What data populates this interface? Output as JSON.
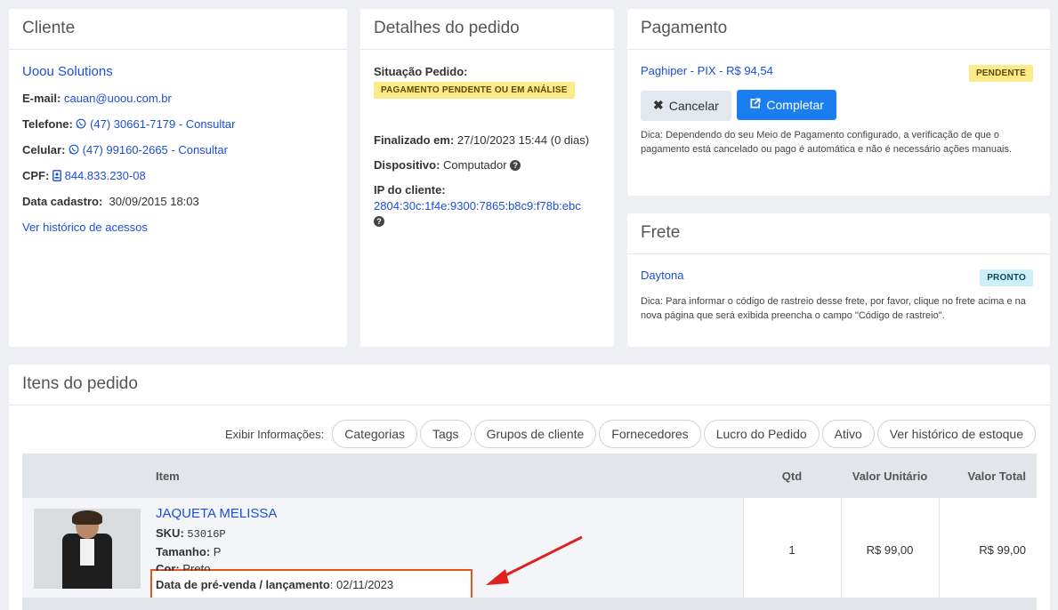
{
  "cliente": {
    "title": "Cliente",
    "name": "Uoou Solutions",
    "email_label": "E-mail:",
    "email": "cauan@uoou.com.br",
    "telefone_label": "Telefone:",
    "telefone": "(47) 30661-7179 - Consultar",
    "celular_label": "Celular:",
    "celular": "(47) 99160-2665 - Consultar",
    "cpf_label": "CPF:",
    "cpf": "844.833.230-08",
    "data_cadastro_label": "Data cadastro:",
    "data_cadastro": "30/09/2015 18:03",
    "historico_link": "Ver histórico de acessos"
  },
  "detalhes": {
    "title": "Detalhes do pedido",
    "situacao_label": "Situação Pedido:",
    "situacao_badge": "PAGAMENTO PENDENTE OU EM ANÁLISE",
    "finalizado_label": "Finalizado em:",
    "finalizado": "27/10/2023 15:44 (0 dias)",
    "dispositivo_label": "Dispositivo:",
    "dispositivo": "Computador",
    "ip_label": "IP do cliente:",
    "ip": "2804:30c:1f4e:9300:7865:b8c9:f78b:ebc"
  },
  "pagamento": {
    "title": "Pagamento",
    "method": "Paghiper - PIX - R$ 94,54",
    "status": "PENDENTE",
    "cancel_label": "Cancelar",
    "complete_label": "Completar",
    "hint": "Dica: Dependendo do seu Meio de Pagamento configurado, a verificação de que o pagamento está cancelado ou pago é automática e não é necessário ações manuais."
  },
  "frete": {
    "title": "Frete",
    "carrier": "Daytona",
    "status": "PRONTO",
    "hint": "Dica: Para informar o código de rastreio desse frete, por favor, clique no frete acima e na nova página que será exibida preencha o campo \"Código de rastreio\"."
  },
  "itens": {
    "title": "Itens do pedido",
    "exibir_label": "Exibir Informações:",
    "filters": [
      "Categorias",
      "Tags",
      "Grupos de cliente",
      "Fornecedores",
      "Lucro do Pedido",
      "Ativo",
      "Ver histórico de estoque"
    ],
    "columns": {
      "item": "Item",
      "qtd": "Qtd",
      "unit": "Valor Unitário",
      "total": "Valor Total"
    },
    "rows": [
      {
        "name": "JAQUETA MELISSA",
        "sku_label": "SKU",
        "sku": "53016P",
        "tamanho_label": "Tamanho",
        "tamanho": "P",
        "cor_label": "Cor",
        "cor": "Preto",
        "prevenda_label": "Data de pré-venda / lançamento",
        "prevenda": "02/11/2023",
        "qtd": "1",
        "unit": "R$ 99,00",
        "total": "R$ 99,00"
      }
    ]
  },
  "colors": {
    "accent": "#1a7ef0",
    "link": "#1d4ed8",
    "highlight_box": "#e8541e",
    "arrow": "#e0201c"
  }
}
